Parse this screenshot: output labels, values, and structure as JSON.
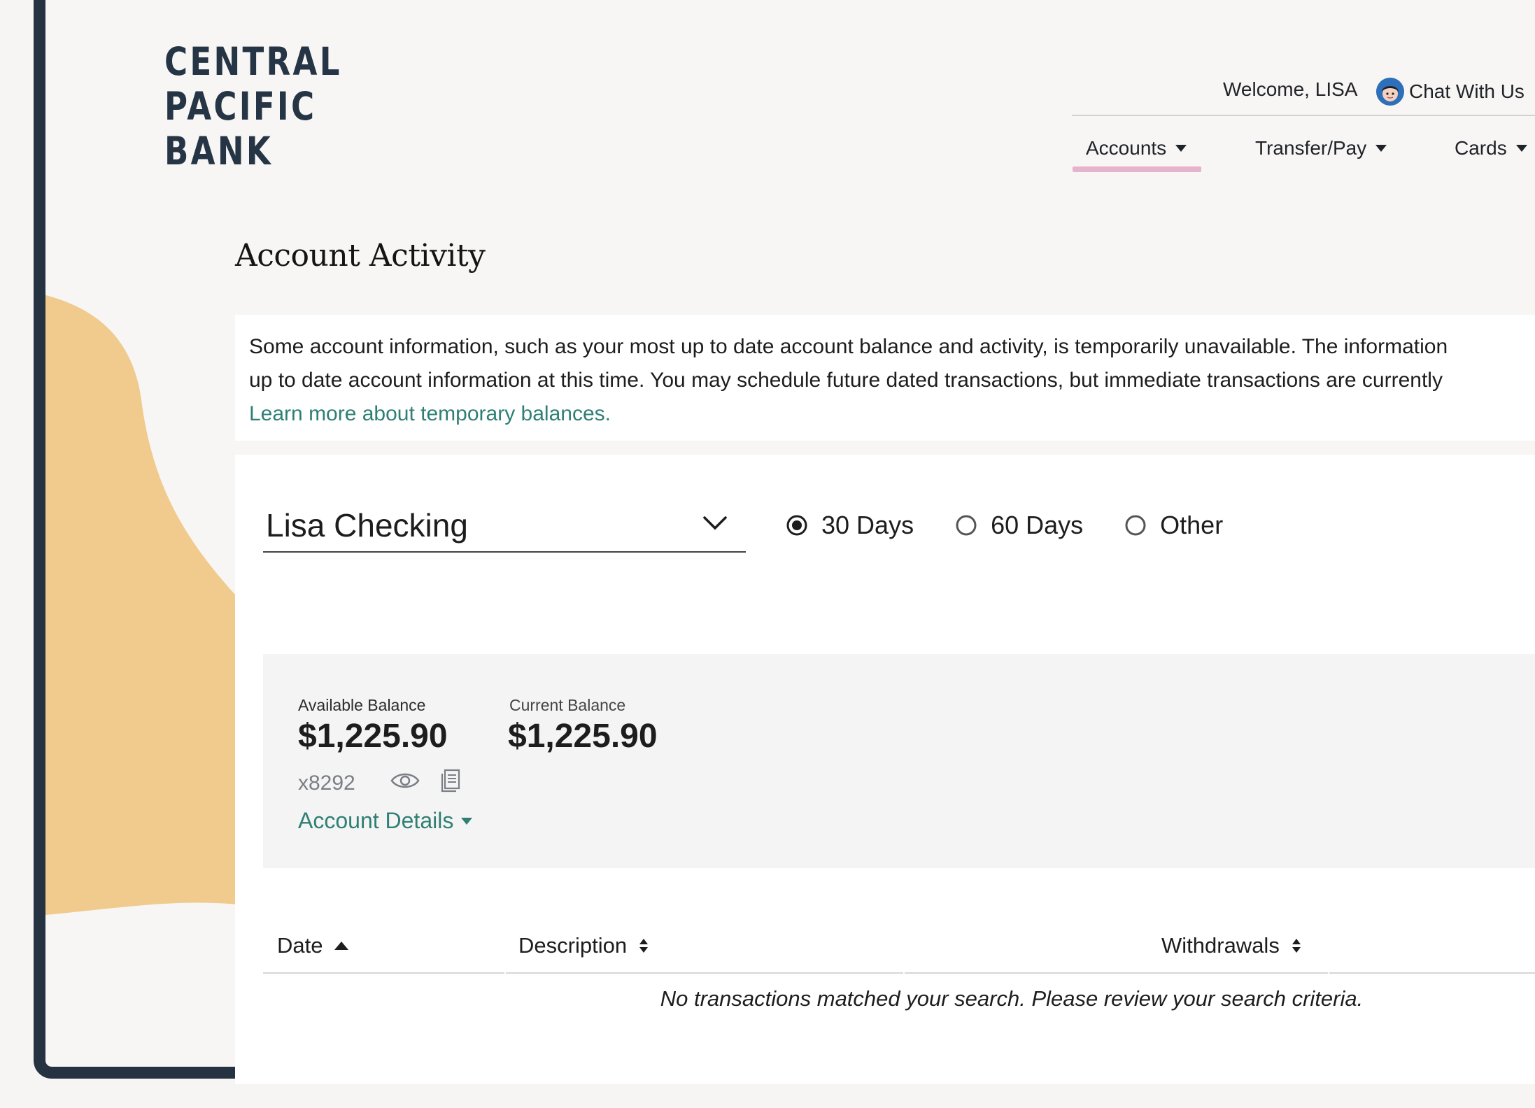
{
  "bank": {
    "logo_lines": [
      "CENTRAL",
      "PACIFIC",
      "BANK"
    ]
  },
  "header": {
    "welcome": "Welcome, LISA",
    "chat_label": "Chat With Us",
    "nav": [
      {
        "label": "Accounts",
        "active": true
      },
      {
        "label": "Transfer/Pay",
        "active": false
      },
      {
        "label": "Cards",
        "active": false
      }
    ]
  },
  "page": {
    "title": "Account Activity"
  },
  "notice": {
    "line1": "Some account information, such as your most up to date account balance and activity, is temporarily unavailable. The information",
    "line2": "up to date account information at this time. You may schedule future dated transactions, but immediate transactions are currently",
    "link": "Learn more about temporary balances."
  },
  "filters": {
    "account_select": "Lisa Checking",
    "periods": [
      {
        "label": "30 Days",
        "selected": true
      },
      {
        "label": "60 Days",
        "selected": false
      },
      {
        "label": "Other",
        "selected": false
      }
    ]
  },
  "balances": {
    "available_label": "Available Balance",
    "available_value": "$1,225.90",
    "current_label": "Current Balance",
    "current_value": "$1,225.90",
    "account_number": "x8292",
    "details_link": "Account Details"
  },
  "table": {
    "columns": [
      "Date",
      "Description",
      "Withdrawals"
    ],
    "empty_message": "No transactions matched your search. Please review your search criteria."
  },
  "colors": {
    "accent_teal": "#2f7f74",
    "nav_underline": "#e6b3cd",
    "blob": "#f0cb8d",
    "frame": "#243242"
  },
  "icons": [
    "chevron-down-icon",
    "caret-down-icon",
    "eye-icon",
    "document-icon",
    "sort-asc-icon",
    "sort-icon",
    "radio-icon",
    "chat-avatar-icon"
  ]
}
